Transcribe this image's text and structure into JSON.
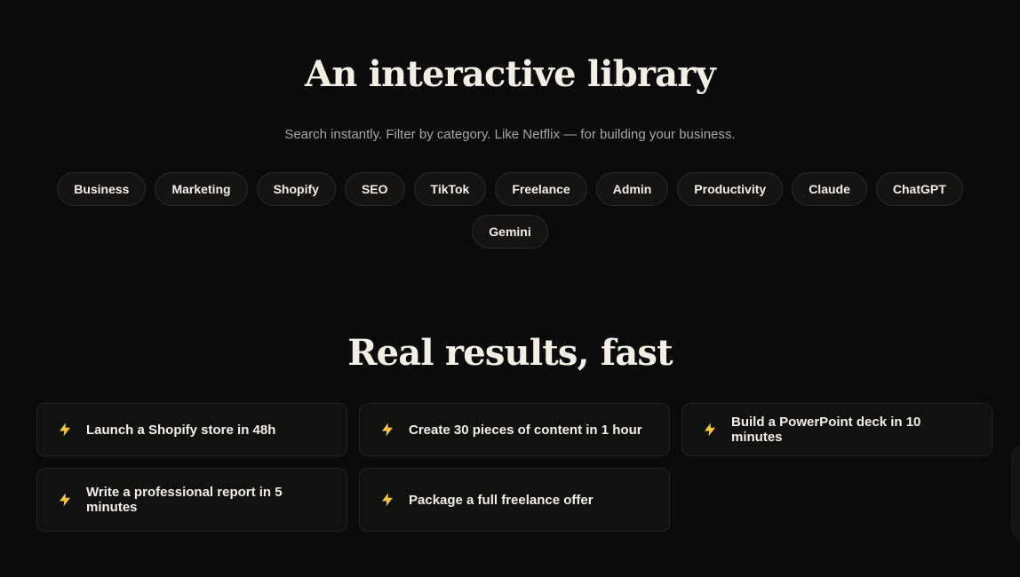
{
  "library": {
    "title": "An interactive library",
    "subtitle": "Search instantly. Filter by category. Like Netflix — for building your business.",
    "categories": [
      "Business",
      "Marketing",
      "Shopify",
      "SEO",
      "TikTok",
      "Freelance",
      "Admin",
      "Productivity",
      "Claude",
      "ChatGPT",
      "Gemini"
    ]
  },
  "results": {
    "title": "Real results, fast",
    "items": [
      "Launch a Shopify store in 48h",
      "Create 30 pieces of content in 1 hour",
      "Build a PowerPoint deck in 10 minutes",
      "Write a professional report in 5 minutes",
      "Package a full freelance offer"
    ]
  },
  "colors": {
    "background": "#0b0b0b",
    "accent": "#f2c53d",
    "text": "#f3efe6",
    "muted": "#a9a59d"
  },
  "icons": {
    "result_item": "lightning-bolt-icon"
  }
}
